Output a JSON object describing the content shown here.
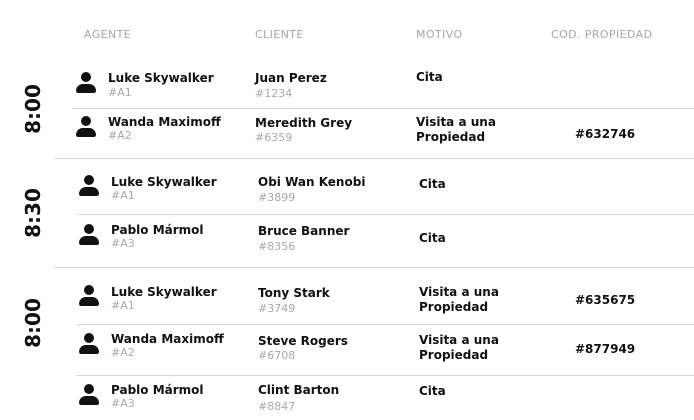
{
  "headers": {
    "agente": "AGENTE",
    "cliente": "CLIENTE",
    "motivo": "MOTIVO",
    "cod_propiedad": "COD. PROPIEDAD"
  },
  "groups": [
    {
      "time": "8:00",
      "rows": [
        {
          "agent_name": "Luke Skywalker",
          "agent_id": "#A1",
          "client_name": "Juan Perez",
          "client_id": "#1234",
          "motivo": "Cita",
          "cod": ""
        },
        {
          "agent_name": "Wanda Maximoff",
          "agent_id": "#A2",
          "client_name": "Meredith Grey",
          "client_id": "#6359",
          "motivo": "Visita a una Propiedad",
          "cod": "#632746"
        }
      ]
    },
    {
      "time": "8:30",
      "rows": [
        {
          "agent_name": "Luke Skywalker",
          "agent_id": "#A1",
          "client_name": "Obi Wan Kenobi",
          "client_id": "#3899",
          "motivo": "Cita",
          "cod": ""
        },
        {
          "agent_name": "Pablo Mármol",
          "agent_id": "#A3",
          "client_name": "Bruce Banner",
          "client_id": "#8356",
          "motivo": "Cita",
          "cod": ""
        }
      ]
    },
    {
      "time": "8:00",
      "rows": [
        {
          "agent_name": "Luke Skywalker",
          "agent_id": "#A1",
          "client_name": "Tony Stark",
          "client_id": "#3749",
          "motivo": "Visita a una Propiedad",
          "cod": "#635675"
        },
        {
          "agent_name": "Wanda Maximoff",
          "agent_id": "#A2",
          "client_name": "Steve Rogers",
          "client_id": "#6708",
          "motivo": "Visita a una Propiedad",
          "cod": "#877949"
        },
        {
          "agent_name": "Pablo Mármol",
          "agent_id": "#A3",
          "client_name": "Clint Barton",
          "client_id": "#8847",
          "motivo": "Cita",
          "cod": ""
        }
      ]
    }
  ]
}
